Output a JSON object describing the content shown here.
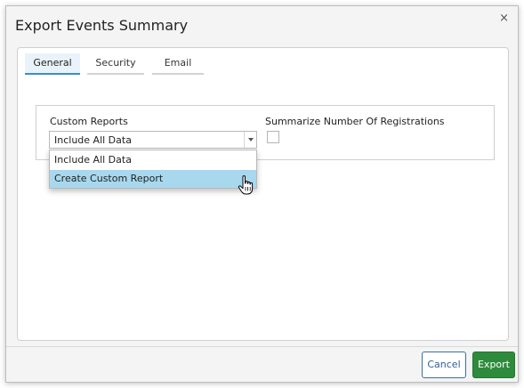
{
  "dialog": {
    "title": "Export Events Summary",
    "close_glyph": "×"
  },
  "tabs": [
    {
      "label": "General",
      "active": true
    },
    {
      "label": "Security",
      "active": false
    },
    {
      "label": "Email",
      "active": false
    }
  ],
  "general": {
    "custom_reports": {
      "label": "Custom Reports",
      "selected": "Include All Data",
      "options": [
        "Include All Data",
        "Create Custom Report"
      ],
      "highlighted_index": 1
    },
    "summarize": {
      "label": "Summarize Number Of Registrations",
      "checked": false
    }
  },
  "buttons": {
    "cancel": "Cancel",
    "export": "Export"
  },
  "colors": {
    "tab_active_border": "#3b8ed0",
    "option_highlight": "#a8d8ee",
    "export_bg": "#2e8b3c",
    "cancel_border": "#3b6fa5"
  },
  "icons": {
    "close": "close-icon",
    "dropdown_arrow": "chevron-down-icon",
    "cursor": "hand-pointer-icon"
  }
}
